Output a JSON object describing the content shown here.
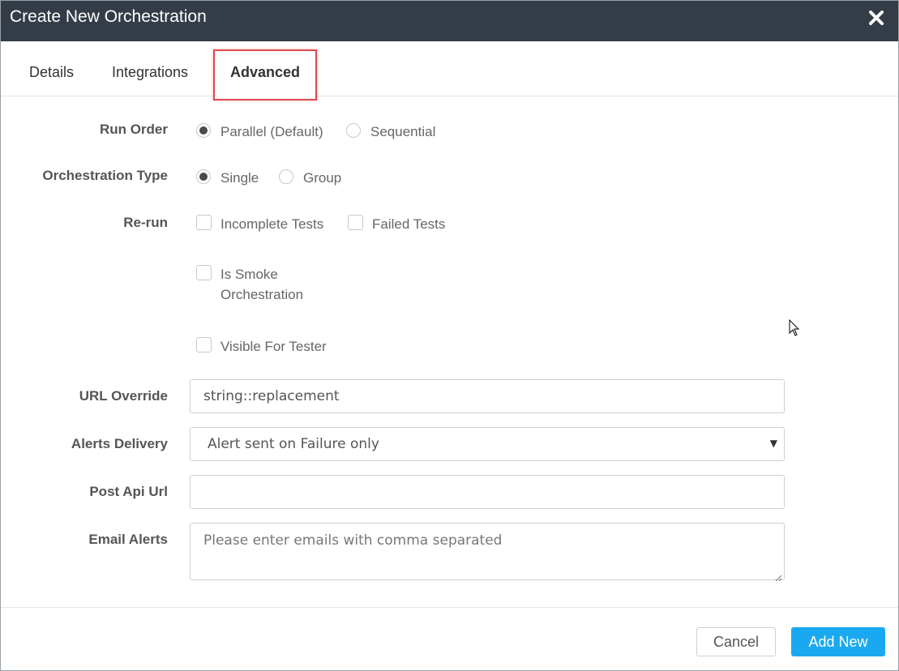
{
  "dialog": {
    "title": "Create New Orchestration",
    "close_icon": "close-icon"
  },
  "tabs": [
    {
      "label": "Details",
      "active": false
    },
    {
      "label": "Integrations",
      "active": false
    },
    {
      "label": "Advanced",
      "active": true
    }
  ],
  "form": {
    "run_order": {
      "label": "Run Order",
      "options": [
        {
          "label": "Parallel (Default)",
          "checked": true
        },
        {
          "label": "Sequential",
          "checked": false
        }
      ]
    },
    "orchestration_type": {
      "label": "Orchestration Type",
      "options": [
        {
          "label": "Single",
          "checked": true
        },
        {
          "label": "Group",
          "checked": false
        }
      ]
    },
    "rerun": {
      "label": "Re-run",
      "options": [
        {
          "label": "Incomplete Tests",
          "checked": false
        },
        {
          "label": "Failed Tests",
          "checked": false
        }
      ]
    },
    "is_smoke": {
      "label_line1": "Is Smoke",
      "label_line2": "Orchestration",
      "checked": false
    },
    "visible_for_tester": {
      "label": "Visible For Tester",
      "checked": false
    },
    "url_override": {
      "label": "URL Override",
      "value": "string::replacement"
    },
    "alerts_delivery": {
      "label": "Alerts Delivery",
      "value": "Alert sent on Failure only"
    },
    "post_api_url": {
      "label": "Post Api Url",
      "value": ""
    },
    "email_alerts": {
      "label": "Email Alerts",
      "placeholder": "Please enter emails with comma separated"
    }
  },
  "footer": {
    "cancel_label": "Cancel",
    "add_label": "Add New"
  },
  "colors": {
    "titlebar": "#343d47",
    "primary": "#1aa9f0",
    "highlight": "#e0474c"
  }
}
